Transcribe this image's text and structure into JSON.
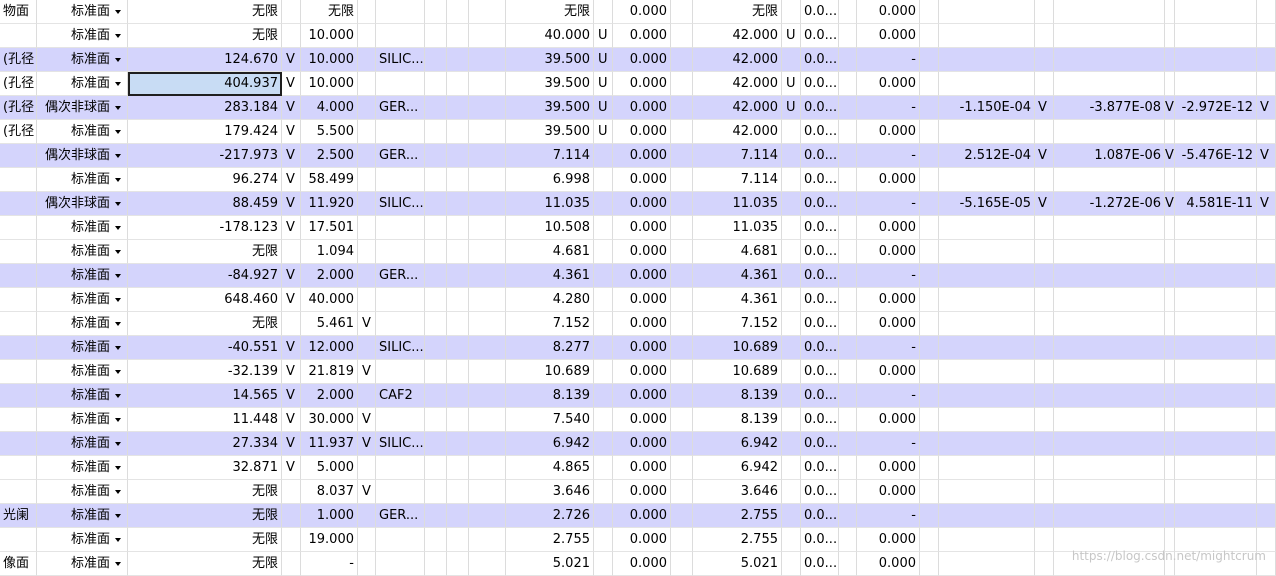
{
  "rows": [
    {
      "comment": "物面",
      "type": "标准面",
      "radius": "无限",
      "rm": "",
      "thick": "无限",
      "tm": "",
      "mat": "",
      "sd": "无限",
      "sdm": "",
      "chip": "0.000",
      "mech": "无限",
      "mm": "",
      "cone": "0.0...",
      "tce": "0.000",
      "p1": "",
      "p1m": "",
      "p2": "",
      "p2m": "",
      "p3": "",
      "p3m": "",
      "hl": false
    },
    {
      "comment": "",
      "type": "标准面",
      "radius": "无限",
      "rm": "",
      "thick": "10.000",
      "tm": "",
      "mat": "",
      "sd": "40.000",
      "sdm": "U",
      "chip": "0.000",
      "mech": "42.000",
      "mm": "U",
      "cone": "0.0...",
      "tce": "0.000",
      "p1": "",
      "p1m": "",
      "p2": "",
      "p2m": "",
      "p3": "",
      "p3m": "",
      "hl": false
    },
    {
      "comment": "(孔径",
      "type": "标准面",
      "radius": "124.670",
      "rm": "V",
      "thick": "10.000",
      "tm": "",
      "mat": "SILIC...",
      "sd": "39.500",
      "sdm": "U",
      "chip": "0.000",
      "mech": "42.000",
      "mm": "",
      "cone": "0.0...",
      "tce": "-",
      "p1": "",
      "p1m": "",
      "p2": "",
      "p2m": "",
      "p3": "",
      "p3m": "",
      "hl": true
    },
    {
      "comment": "(孔径",
      "type": "标准面",
      "radius": "404.937",
      "rm": "V",
      "thick": "10.000",
      "tm": "",
      "mat": "",
      "sd": "39.500",
      "sdm": "U",
      "chip": "0.000",
      "mech": "42.000",
      "mm": "U",
      "cone": "0.0...",
      "tce": "0.000",
      "p1": "",
      "p1m": "",
      "p2": "",
      "p2m": "",
      "p3": "",
      "p3m": "",
      "hl": false,
      "sel": true
    },
    {
      "comment": "(孔径",
      "type": "偶次非球面",
      "radius": "283.184",
      "rm": "V",
      "thick": "4.000",
      "tm": "",
      "mat": "GER...",
      "sd": "39.500",
      "sdm": "U",
      "chip": "0.000",
      "mech": "42.000",
      "mm": "U",
      "cone": "0.0...",
      "tce": "-",
      "p1": "-1.150E-04",
      "p1m": "V",
      "p2": "-3.877E-08",
      "p2m": "V",
      "p3": "-2.972E-12",
      "p3m": "V",
      "hl": true
    },
    {
      "comment": "(孔径",
      "type": "标准面",
      "radius": "179.424",
      "rm": "V",
      "thick": "5.500",
      "tm": "",
      "mat": "",
      "sd": "39.500",
      "sdm": "U",
      "chip": "0.000",
      "mech": "42.000",
      "mm": "",
      "cone": "0.0...",
      "tce": "0.000",
      "p1": "",
      "p1m": "",
      "p2": "",
      "p2m": "",
      "p3": "",
      "p3m": "",
      "hl": false
    },
    {
      "comment": "",
      "type": "偶次非球面",
      "radius": "-217.973",
      "rm": "V",
      "thick": "2.500",
      "tm": "",
      "mat": "GER...",
      "sd": "7.114",
      "sdm": "",
      "chip": "0.000",
      "mech": "7.114",
      "mm": "",
      "cone": "0.0...",
      "tce": "-",
      "p1": "2.512E-04",
      "p1m": "V",
      "p2": "1.087E-06",
      "p2m": "V",
      "p3": "-5.476E-12",
      "p3m": "V",
      "hl": true
    },
    {
      "comment": "",
      "type": "标准面",
      "radius": "96.274",
      "rm": "V",
      "thick": "58.499",
      "tm": "",
      "mat": "",
      "sd": "6.998",
      "sdm": "",
      "chip": "0.000",
      "mech": "7.114",
      "mm": "",
      "cone": "0.0...",
      "tce": "0.000",
      "p1": "",
      "p1m": "",
      "p2": "",
      "p2m": "",
      "p3": "",
      "p3m": "",
      "hl": false
    },
    {
      "comment": "",
      "type": "偶次非球面",
      "radius": "88.459",
      "rm": "V",
      "thick": "11.920",
      "tm": "",
      "mat": "SILIC...",
      "sd": "11.035",
      "sdm": "",
      "chip": "0.000",
      "mech": "11.035",
      "mm": "",
      "cone": "0.0...",
      "tce": "-",
      "p1": "-5.165E-05",
      "p1m": "V",
      "p2": "-1.272E-06",
      "p2m": "V",
      "p3": "4.581E-11",
      "p3m": "V",
      "hl": true
    },
    {
      "comment": "",
      "type": "标准面",
      "radius": "-178.123",
      "rm": "V",
      "thick": "17.501",
      "tm": "",
      "mat": "",
      "sd": "10.508",
      "sdm": "",
      "chip": "0.000",
      "mech": "11.035",
      "mm": "",
      "cone": "0.0...",
      "tce": "0.000",
      "p1": "",
      "p1m": "",
      "p2": "",
      "p2m": "",
      "p3": "",
      "p3m": "",
      "hl": false
    },
    {
      "comment": "",
      "type": "标准面",
      "radius": "无限",
      "rm": "",
      "thick": "1.094",
      "tm": "",
      "mat": "",
      "sd": "4.681",
      "sdm": "",
      "chip": "0.000",
      "mech": "4.681",
      "mm": "",
      "cone": "0.0...",
      "tce": "0.000",
      "p1": "",
      "p1m": "",
      "p2": "",
      "p2m": "",
      "p3": "",
      "p3m": "",
      "hl": false
    },
    {
      "comment": "",
      "type": "标准面",
      "radius": "-84.927",
      "rm": "V",
      "thick": "2.000",
      "tm": "",
      "mat": "GER...",
      "sd": "4.361",
      "sdm": "",
      "chip": "0.000",
      "mech": "4.361",
      "mm": "",
      "cone": "0.0...",
      "tce": "-",
      "p1": "",
      "p1m": "",
      "p2": "",
      "p2m": "",
      "p3": "",
      "p3m": "",
      "hl": true
    },
    {
      "comment": "",
      "type": "标准面",
      "radius": "648.460",
      "rm": "V",
      "thick": "40.000",
      "tm": "",
      "mat": "",
      "sd": "4.280",
      "sdm": "",
      "chip": "0.000",
      "mech": "4.361",
      "mm": "",
      "cone": "0.0...",
      "tce": "0.000",
      "p1": "",
      "p1m": "",
      "p2": "",
      "p2m": "",
      "p3": "",
      "p3m": "",
      "hl": false
    },
    {
      "comment": "",
      "type": "标准面",
      "radius": "无限",
      "rm": "",
      "thick": "5.461",
      "tm": "V",
      "mat": "",
      "sd": "7.152",
      "sdm": "",
      "chip": "0.000",
      "mech": "7.152",
      "mm": "",
      "cone": "0.0...",
      "tce": "0.000",
      "p1": "",
      "p1m": "",
      "p2": "",
      "p2m": "",
      "p3": "",
      "p3m": "",
      "hl": false
    },
    {
      "comment": "",
      "type": "标准面",
      "radius": "-40.551",
      "rm": "V",
      "thick": "12.000",
      "tm": "",
      "mat": "SILIC...",
      "sd": "8.277",
      "sdm": "",
      "chip": "0.000",
      "mech": "10.689",
      "mm": "",
      "cone": "0.0...",
      "tce": "-",
      "p1": "",
      "p1m": "",
      "p2": "",
      "p2m": "",
      "p3": "",
      "p3m": "",
      "hl": true
    },
    {
      "comment": "",
      "type": "标准面",
      "radius": "-32.139",
      "rm": "V",
      "thick": "21.819",
      "tm": "V",
      "mat": "",
      "sd": "10.689",
      "sdm": "",
      "chip": "0.000",
      "mech": "10.689",
      "mm": "",
      "cone": "0.0...",
      "tce": "0.000",
      "p1": "",
      "p1m": "",
      "p2": "",
      "p2m": "",
      "p3": "",
      "p3m": "",
      "hl": false
    },
    {
      "comment": "",
      "type": "标准面",
      "radius": "14.565",
      "rm": "V",
      "thick": "2.000",
      "tm": "",
      "mat": "CAF2",
      "sd": "8.139",
      "sdm": "",
      "chip": "0.000",
      "mech": "8.139",
      "mm": "",
      "cone": "0.0...",
      "tce": "-",
      "p1": "",
      "p1m": "",
      "p2": "",
      "p2m": "",
      "p3": "",
      "p3m": "",
      "hl": true
    },
    {
      "comment": "",
      "type": "标准面",
      "radius": "11.448",
      "rm": "V",
      "thick": "30.000",
      "tm": "V",
      "mat": "",
      "sd": "7.540",
      "sdm": "",
      "chip": "0.000",
      "mech": "8.139",
      "mm": "",
      "cone": "0.0...",
      "tce": "0.000",
      "p1": "",
      "p1m": "",
      "p2": "",
      "p2m": "",
      "p3": "",
      "p3m": "",
      "hl": false
    },
    {
      "comment": "",
      "type": "标准面",
      "radius": "27.334",
      "rm": "V",
      "thick": "11.937",
      "tm": "V",
      "mat": "SILIC...",
      "sd": "6.942",
      "sdm": "",
      "chip": "0.000",
      "mech": "6.942",
      "mm": "",
      "cone": "0.0...",
      "tce": "-",
      "p1": "",
      "p1m": "",
      "p2": "",
      "p2m": "",
      "p3": "",
      "p3m": "",
      "hl": true
    },
    {
      "comment": "",
      "type": "标准面",
      "radius": "32.871",
      "rm": "V",
      "thick": "5.000",
      "tm": "",
      "mat": "",
      "sd": "4.865",
      "sdm": "",
      "chip": "0.000",
      "mech": "6.942",
      "mm": "",
      "cone": "0.0...",
      "tce": "0.000",
      "p1": "",
      "p1m": "",
      "p2": "",
      "p2m": "",
      "p3": "",
      "p3m": "",
      "hl": false
    },
    {
      "comment": "",
      "type": "标准面",
      "radius": "无限",
      "rm": "",
      "thick": "8.037",
      "tm": "V",
      "mat": "",
      "sd": "3.646",
      "sdm": "",
      "chip": "0.000",
      "mech": "3.646",
      "mm": "",
      "cone": "0.0...",
      "tce": "0.000",
      "p1": "",
      "p1m": "",
      "p2": "",
      "p2m": "",
      "p3": "",
      "p3m": "",
      "hl": false
    },
    {
      "comment": "光阑",
      "type": "标准面",
      "radius": "无限",
      "rm": "",
      "thick": "1.000",
      "tm": "",
      "mat": "GER...",
      "sd": "2.726",
      "sdm": "",
      "chip": "0.000",
      "mech": "2.755",
      "mm": "",
      "cone": "0.0...",
      "tce": "-",
      "p1": "",
      "p1m": "",
      "p2": "",
      "p2m": "",
      "p3": "",
      "p3m": "",
      "hl": true
    },
    {
      "comment": "",
      "type": "标准面",
      "radius": "无限",
      "rm": "",
      "thick": "19.000",
      "tm": "",
      "mat": "",
      "sd": "2.755",
      "sdm": "",
      "chip": "0.000",
      "mech": "2.755",
      "mm": "",
      "cone": "0.0...",
      "tce": "0.000",
      "p1": "",
      "p1m": "",
      "p2": "",
      "p2m": "",
      "p3": "",
      "p3m": "",
      "hl": false
    },
    {
      "comment": "像面",
      "type": "标准面",
      "radius": "无限",
      "rm": "",
      "thick": "-",
      "tm": "",
      "mat": "",
      "sd": "5.021",
      "sdm": "",
      "chip": "0.000",
      "mech": "5.021",
      "mm": "",
      "cone": "0.0...",
      "tce": "0.000",
      "p1": "",
      "p1m": "",
      "p2": "",
      "p2m": "",
      "p3": "",
      "p3m": "",
      "hl": false
    }
  ],
  "watermark": "https://blog.csdn.net/mightcrum",
  "colors": {
    "highlight_row": "#d4d4fc",
    "selected_cell": "#c8dcf4"
  }
}
